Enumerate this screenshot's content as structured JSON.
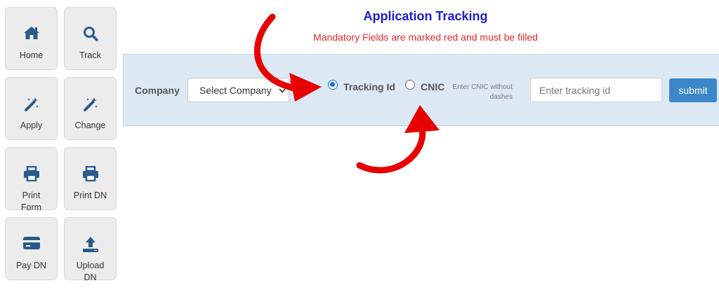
{
  "sidebar": {
    "items": [
      {
        "label": "Home",
        "icon": "home-icon"
      },
      {
        "label": "Track",
        "icon": "search-icon"
      },
      {
        "label": "Apply",
        "icon": "magic-wand-icon"
      },
      {
        "label": "Change",
        "icon": "magic-wand-icon"
      },
      {
        "label": "Print Form",
        "icon": "printer-icon"
      },
      {
        "label": "Print DN",
        "icon": "printer-icon"
      },
      {
        "label": "Pay DN",
        "icon": "credit-card-icon"
      },
      {
        "label": "Upload DN",
        "icon": "upload-icon"
      }
    ]
  },
  "header": {
    "title": "Application Tracking",
    "subtitle": "Mandatory Fields are marked red and must be filled"
  },
  "form": {
    "company_label": "Company",
    "company_select_value": "Select Company",
    "options": [
      {
        "label": "Tracking Id",
        "checked": true
      },
      {
        "label": "CNIC",
        "checked": false
      }
    ],
    "cnic_hint": "Enter CNIC without dashes",
    "tracking_input_placeholder": "Enter tracking id",
    "submit_label": "submit"
  },
  "colors": {
    "title": "#1b1bd6",
    "subtitle": "#e8262a",
    "panel": "#dde8f5",
    "submit": "#3b87c9",
    "icon": "#2a5a8a",
    "annotation_arrows": "#e60000"
  }
}
